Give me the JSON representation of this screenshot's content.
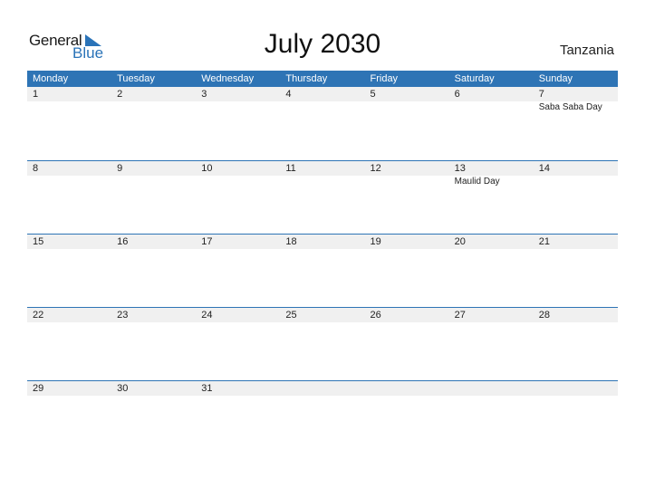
{
  "logo": {
    "general": "General",
    "blue": "Blue"
  },
  "title": "July 2030",
  "country": "Tanzania",
  "weekdays": [
    "Monday",
    "Tuesday",
    "Wednesday",
    "Thursday",
    "Friday",
    "Saturday",
    "Sunday"
  ],
  "weeks": [
    {
      "days": [
        "1",
        "2",
        "3",
        "4",
        "5",
        "6",
        "7"
      ],
      "events": [
        "",
        "",
        "",
        "",
        "",
        "",
        "Saba Saba Day"
      ]
    },
    {
      "days": [
        "8",
        "9",
        "10",
        "11",
        "12",
        "13",
        "14"
      ],
      "events": [
        "",
        "",
        "",
        "",
        "",
        "Maulid Day",
        ""
      ]
    },
    {
      "days": [
        "15",
        "16",
        "17",
        "18",
        "19",
        "20",
        "21"
      ],
      "events": [
        "",
        "",
        "",
        "",
        "",
        "",
        ""
      ]
    },
    {
      "days": [
        "22",
        "23",
        "24",
        "25",
        "26",
        "27",
        "28"
      ],
      "events": [
        "",
        "",
        "",
        "",
        "",
        "",
        ""
      ]
    },
    {
      "days": [
        "29",
        "30",
        "31",
        "",
        "",
        "",
        ""
      ],
      "events": [
        "",
        "",
        "",
        "",
        "",
        "",
        ""
      ]
    }
  ],
  "colors": {
    "accent": "#2e74b5",
    "row_bg": "#f0f0f0"
  }
}
